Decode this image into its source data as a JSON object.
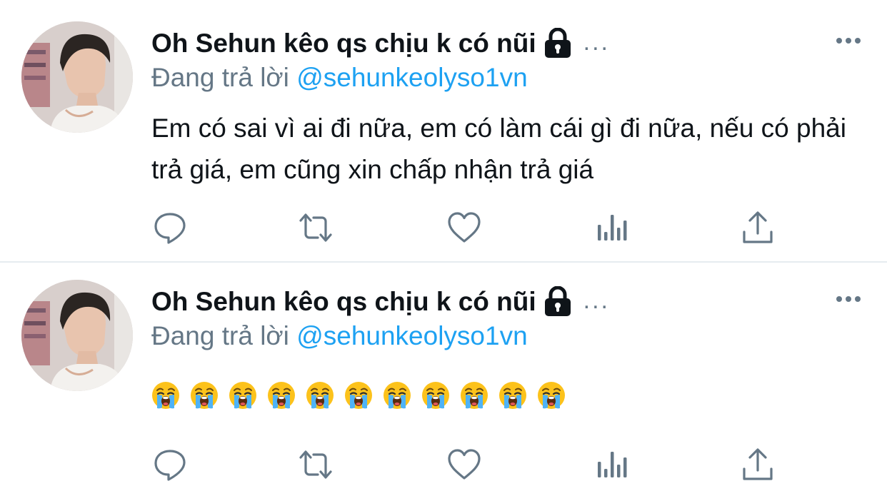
{
  "colors": {
    "text": "#0f1419",
    "secondary": "#657786",
    "link": "#1da1f2",
    "divider": "#e6ecf0"
  },
  "tweets": [
    {
      "author": {
        "display_name": "Oh Sehun kêo qs chịu k có nũi",
        "protected_icon": "lock-icon",
        "truncation": "..."
      },
      "reply": {
        "prefix": "Đang trả lời",
        "handle": "@sehunkeolyso1vn"
      },
      "text": "Em có sai vì ai đi nữa, em có làm cái gì đi nữa, nếu có phải trả giá, em cũng xin chấp nhận trả giá",
      "actions": [
        "reply-icon",
        "retweet-icon",
        "like-icon",
        "analytics-icon",
        "share-icon"
      ]
    },
    {
      "author": {
        "display_name": "Oh Sehun kêo qs chịu k có nũi",
        "protected_icon": "lock-icon",
        "truncation": "..."
      },
      "reply": {
        "prefix": "Đang trả lời",
        "handle": "@sehunkeolyso1vn"
      },
      "emoji": {
        "name": "loudly-crying-face-emoji",
        "count": 11
      },
      "actions": [
        "reply-icon",
        "retweet-icon",
        "like-icon",
        "analytics-icon",
        "share-icon"
      ]
    }
  ]
}
